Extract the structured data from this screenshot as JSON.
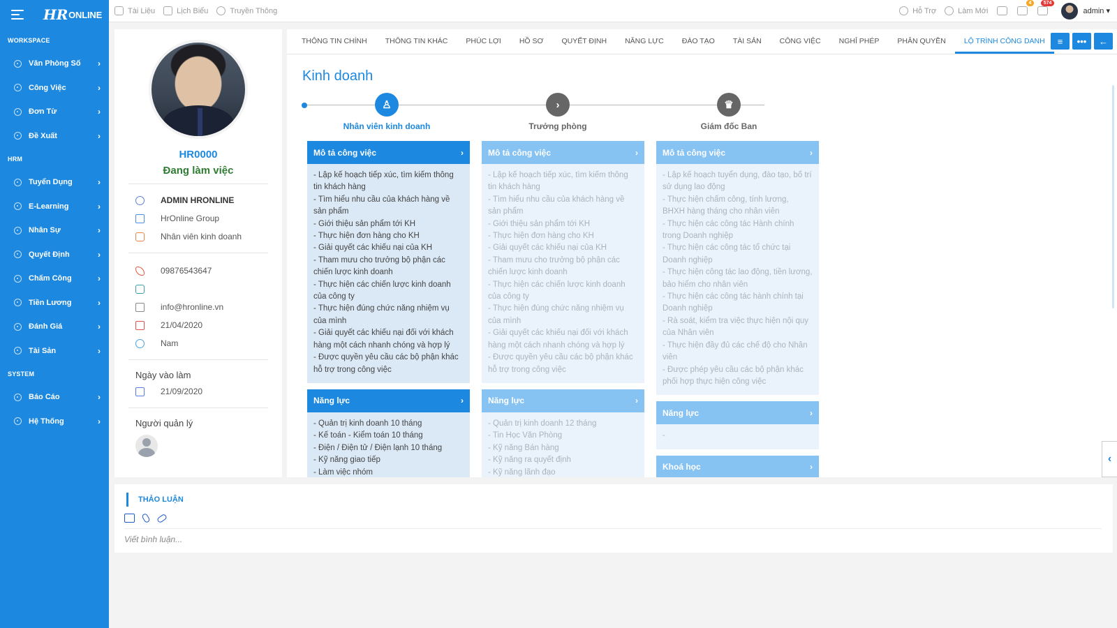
{
  "app": {
    "logo_mark": "HR",
    "logo_text": "ONLINE"
  },
  "sidebar": {
    "sections": [
      {
        "title": "WORKSPACE",
        "items": [
          "Văn Phòng Số",
          "Công Việc",
          "Đơn Từ",
          "Đề Xuất"
        ]
      },
      {
        "title": "HRM",
        "items": [
          "Tuyển Dụng",
          "E-Learning",
          "Nhân Sự",
          "Quyết Định",
          "Chấm Công",
          "Tiền Lương",
          "Đánh Giá",
          "Tài Sản"
        ]
      },
      {
        "title": "SYSTEM",
        "items": [
          "Báo Cáo",
          "Hệ Thống"
        ]
      }
    ]
  },
  "topbar": {
    "links": [
      "Tài Liệu",
      "Lịch Biểu",
      "Truyền Thông"
    ],
    "support": "Hỗ Trợ",
    "refresh": "Làm Mới",
    "messages_count": "4",
    "notifications_count": "574",
    "user": "admin ▾"
  },
  "profile": {
    "code": "HR0000",
    "status": "Đang làm việc",
    "name": "ADMIN HRONLINE",
    "company": "HrOnline Group",
    "position": "Nhân viên kinh doanh",
    "phone": "09876543647",
    "fax": "",
    "email": "info@hronline.vn",
    "birthday": "21/04/2020",
    "gender": "Nam",
    "start_date_label": "Ngày vào làm",
    "start_date": "21/09/2020",
    "manager_label": "Người quản lý"
  },
  "tabs": [
    "THÔNG TIN CHÍNH",
    "THÔNG TIN KHÁC",
    "PHÚC LỢI",
    "HỒ SƠ",
    "QUYẾT ĐỊNH",
    "NĂNG LỰC",
    "ĐÀO TẠO",
    "TÀI SẢN",
    "CÔNG VIỆC",
    "NGHỈ PHÉP",
    "PHÂN QUYỀN",
    "LỘ TRÌNH CÔNG DANH"
  ],
  "active_tab": "LỘ TRÌNH CÔNG DANH",
  "tab_buttons": [
    "≡",
    "•••",
    "←"
  ],
  "career": {
    "title": "Kinh doanh",
    "stages": [
      {
        "label": "Nhân viên kinh doanh",
        "active": true,
        "icon": "person-icon",
        "job_title": "Mô tả công việc",
        "job_items": [
          "- Lập kế hoạch tiếp xúc, tìm kiếm thông tin khách hàng",
          "- Tìm hiểu nhu cầu của khách hàng về sản phẩm",
          "- Giới thiệu sản phẩm tới KH",
          "- Thực hiện đơn hàng cho KH",
          "- Giải quyết các khiếu nại của KH",
          "- Tham mưu cho trưởng bộ phận các chiến lược kinh doanh",
          "- Thực hiện các chiến lược kinh doanh của công ty",
          "- Thực hiện đúng chức năng nhiệm vụ của mình",
          "- Giải quyết các khiếu nại đối với khách hàng một cách nhanh chóng và hợp lý",
          "- Được quyền yêu cầu các bộ phận khác hỗ trợ trong công việc"
        ],
        "skill_title": "Năng lực",
        "skill_items": [
          "- Quản trị kinh doanh 10 tháng",
          "- Kế toán - Kiểm toán 10 tháng",
          "- Điện / Điện tử / Điện lạnh 10 tháng",
          "- Kỹ năng giao tiếp",
          "- Làm việc nhóm"
        ]
      },
      {
        "label": "Trưởng phòng",
        "active": false,
        "icon": "chevron-right-icon",
        "job_title": "Mô tả công việc",
        "job_items": [
          "- Lập kế hoạch tiếp xúc, tìm kiếm thông tin khách hàng",
          "- Tìm hiểu nhu cầu của khách hàng về sản phẩm",
          "- Giới thiệu sản phẩm tới KH",
          "- Thực hiện đơn hàng cho KH",
          "- Giải quyết các khiếu nại của KH",
          "- Tham mưu cho trưởng bộ phận các chiến lược kinh doanh",
          "- Thực hiện các chiến lược kinh doanh của công ty",
          "- Thực hiện đúng chức năng nhiệm vụ của mình",
          "- Giải quyết các khiếu nại đối với khách hàng một cách nhanh chóng và hợp lý",
          "- Được quyền yêu cầu các bộ phận khác hỗ trợ trong công việc"
        ],
        "skill_title": "Năng lực",
        "skill_items": [
          "- Quản trị kinh doanh 12 tháng",
          "- Tin Học Văn Phòng",
          "- Kỹ năng Bán hàng",
          "- Kỹ năng ra quyết định",
          "- Kỹ năng lãnh đạo"
        ]
      },
      {
        "label": "Giám đốc Ban",
        "active": false,
        "icon": "trophy-icon",
        "job_title": "Mô tả công việc",
        "job_items": [
          "- Lập kế hoạch tuyển dụng, đào tạo, bố trí sử dụng lao động",
          "- Thực hiện chấm công, tính lương, BHXH hàng tháng cho nhân viên",
          "- Thực hiện các công tác Hành chính trong Doanh nghiệp",
          "- Thực hiện các công tác tổ chức tại Doanh nghiệp",
          "- Thực hiện công tác lao động, tiền lương, bảo hiểm cho nhân viên",
          "- Thực hiện các công tác hành chính tại Doanh nghiệp",
          "- Rà soát, kiểm tra việc thực hiện nội quy của Nhân viên",
          "- Thực hiện đầy đủ các chế độ cho Nhân viên",
          "- Được phép yêu cầu các bộ phận khác phối hợp thực hiện công việc"
        ],
        "skill_title": "Năng lực",
        "skill_items": [
          "-"
        ],
        "course_title": "Khoá học"
      }
    ]
  },
  "discussion": {
    "title": "THẢO LUẬN",
    "placeholder": "Viết bình luận..."
  },
  "colors": {
    "primary": "#1c88e0",
    "status_green": "#2e7d32"
  }
}
